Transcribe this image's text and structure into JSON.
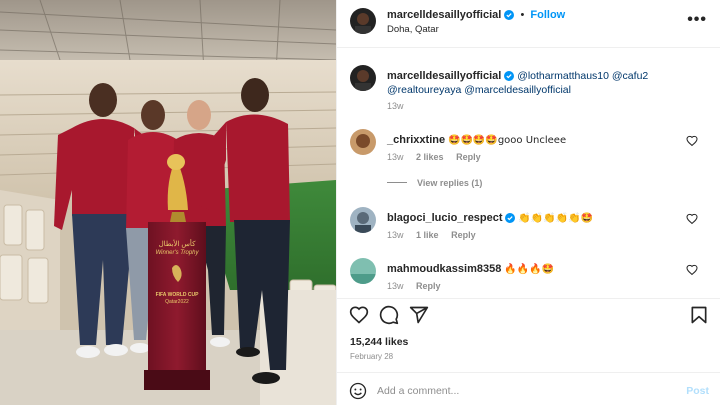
{
  "photo": {
    "trophy_arabic": "كأس الأبطال",
    "trophy_name": "Winner's Trophy",
    "trophy_event": "FIFA WORLD CUP",
    "trophy_place": "Qatar2022"
  },
  "post": {
    "author": "marcelldesaillyofficial",
    "follow_label": "Follow",
    "location": "Doha, Qatar",
    "more_label": "•••",
    "caption_mentions": "@lotharmatthaus10 @cafu2 @realtoureyaya @marceldesaillyofficial",
    "caption_time": "13w",
    "likes": "15,244 likes",
    "date": "February 28"
  },
  "comments": [
    {
      "user": "_chrixxtine",
      "text": "🤩🤩🤩🤩gooo Uncleee",
      "time": "13w",
      "likes": "2 likes",
      "reply": "Reply",
      "view_replies": "View replies (1)"
    },
    {
      "user": "blagoci_lucio_respect",
      "text": "👏👏👏👏👏🤩",
      "time": "13w",
      "likes": "1 like",
      "reply": "Reply"
    },
    {
      "user": "mahmoudkassim8358",
      "text": "🔥🔥🔥🤩",
      "time": "13w",
      "reply": "Reply"
    }
  ],
  "add_comment": {
    "placeholder": "Add a comment...",
    "post_label": "Post"
  },
  "icons": [
    "verified-badge-icon",
    "more-options-icon",
    "heart-icon",
    "comment-icon",
    "share-icon",
    "bookmark-icon",
    "emoji-icon"
  ],
  "colors": {
    "follow_blue": "#0095f6",
    "post_disabled": "#b2dffc",
    "shirt_red": "#a8182e",
    "verified_blue": "#0095f6"
  }
}
